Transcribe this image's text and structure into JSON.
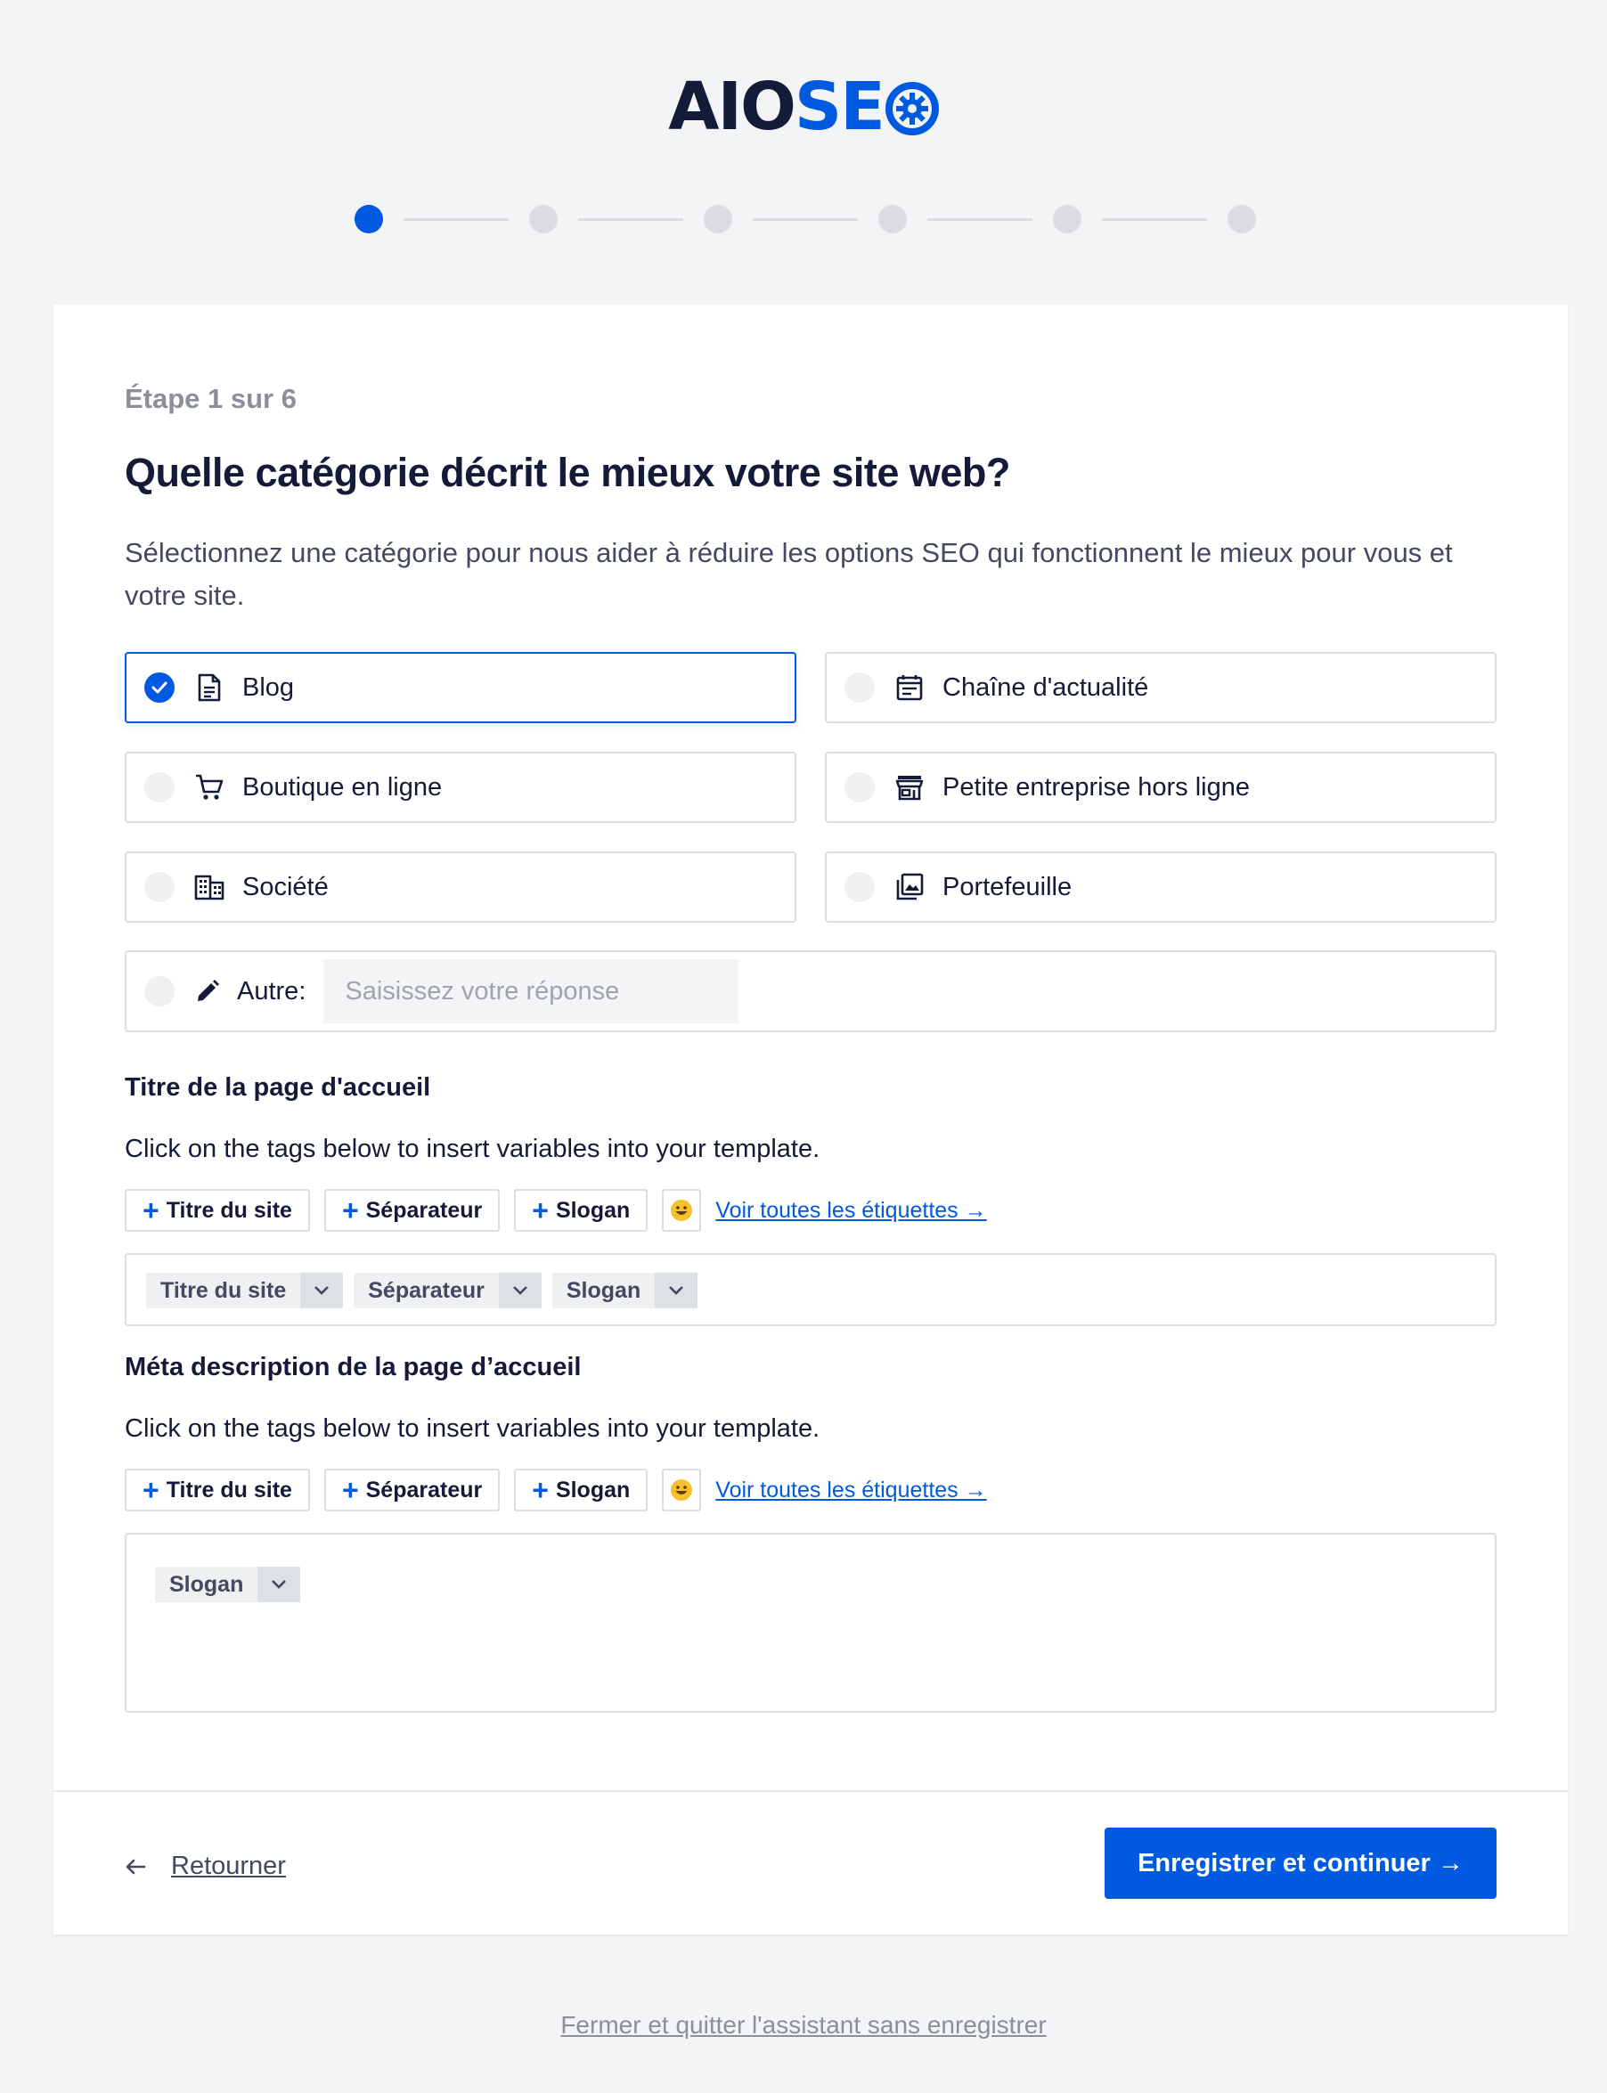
{
  "logo": {
    "part1": "AIO",
    "part2": "SE"
  },
  "steps": {
    "total": 6,
    "current": 1
  },
  "wizard": {
    "step_label": "Étape 1 sur 6",
    "title": "Quelle catégorie décrit le mieux votre site web?",
    "description": "Sélectionnez une catégorie pour nous aider à réduire les options SEO qui fonctionnent le mieux pour vous et votre site."
  },
  "categories": [
    {
      "label": "Blog",
      "icon": "document-icon",
      "selected": true
    },
    {
      "label": "Chaîne d'actualité",
      "icon": "newspaper-icon",
      "selected": false
    },
    {
      "label": "Boutique en ligne",
      "icon": "cart-icon",
      "selected": false
    },
    {
      "label": "Petite entreprise hors ligne",
      "icon": "store-icon",
      "selected": false
    },
    {
      "label": "Société",
      "icon": "building-icon",
      "selected": false
    },
    {
      "label": "Portefeuille",
      "icon": "gallery-icon",
      "selected": false
    }
  ],
  "other": {
    "label": "Autre:",
    "placeholder": "Saisissez votre réponse",
    "value": ""
  },
  "homepage_title": {
    "heading": "Titre de la page d'accueil",
    "hint": "Click on the tags below to insert variables into your template.",
    "tag_buttons": [
      "Titre du site",
      "Séparateur",
      "Slogan"
    ],
    "view_all": "Voir toutes les étiquettes →",
    "chips": [
      "Titre du site",
      "Séparateur",
      "Slogan"
    ]
  },
  "homepage_meta": {
    "heading": "Méta description de la page d’accueil",
    "hint": "Click on the tags below to insert variables into your template.",
    "tag_buttons": [
      "Titre du site",
      "Séparateur",
      "Slogan"
    ],
    "view_all": "Voir toutes les étiquettes →",
    "chips": [
      "Slogan"
    ]
  },
  "footer": {
    "back_label": "Retourner",
    "primary_label": "Enregistrer et continuer →",
    "close_label": "Fermer et quitter l'assistant sans enregistrer"
  },
  "colors": {
    "accent": "#005ae0",
    "text": "#141b38",
    "muted": "#8c8f9a",
    "border": "#dcdde1"
  }
}
